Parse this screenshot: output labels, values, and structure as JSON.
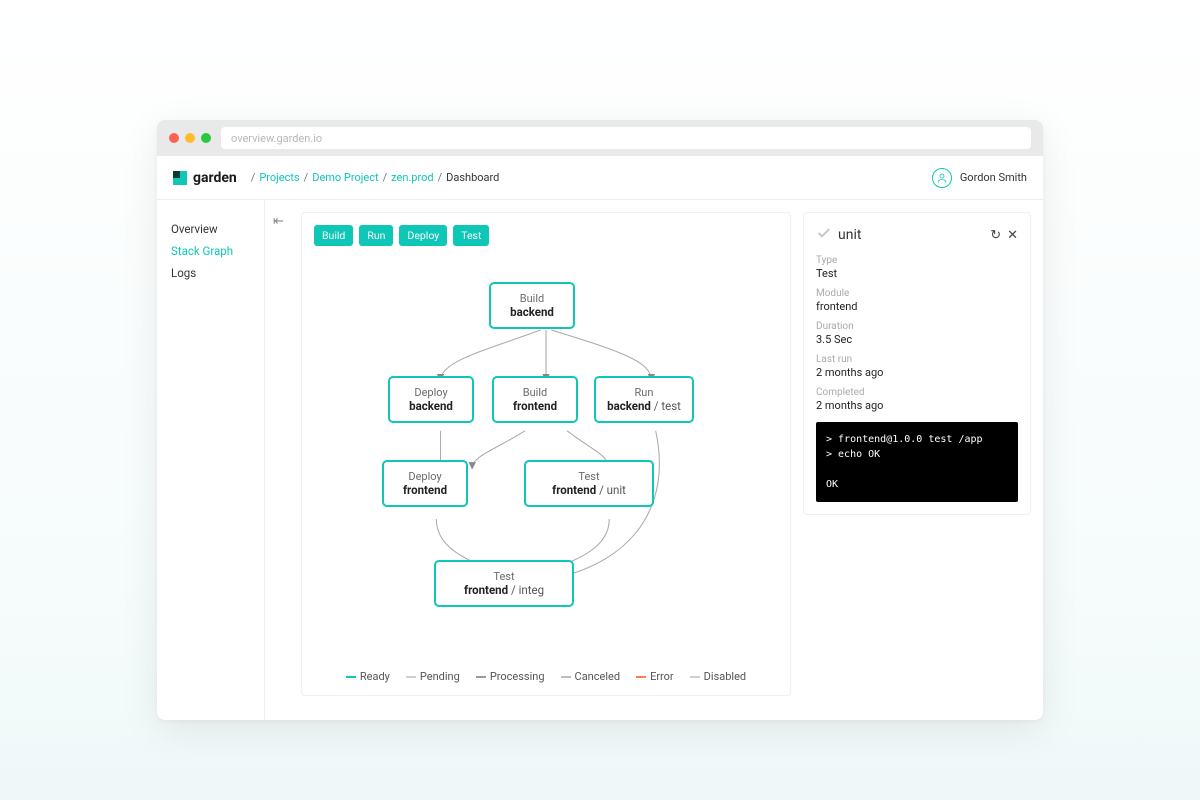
{
  "browser": {
    "url": "overview.garden.io"
  },
  "brand": "garden",
  "breadcrumbs": [
    "Projects",
    "Demo Project",
    "zen.prod",
    "Dashboard"
  ],
  "user": {
    "name": "Gordon Smith"
  },
  "sidebar": {
    "items": [
      {
        "label": "Overview",
        "active": false
      },
      {
        "label": "Stack Graph",
        "active": true
      },
      {
        "label": "Logs",
        "active": false
      }
    ]
  },
  "filters": [
    "Build",
    "Run",
    "Deploy",
    "Test"
  ],
  "legend": [
    {
      "label": "Ready",
      "color": "#0fc7b6"
    },
    {
      "label": "Pending",
      "color": "#cfcfcf"
    },
    {
      "label": "Processing",
      "color": "#9a9a9a"
    },
    {
      "label": "Canceled",
      "color": "#bdbdbd"
    },
    {
      "label": "Error",
      "color": "#ff7a59"
    },
    {
      "label": "Disabled",
      "color": "#d0d0d0"
    }
  ],
  "nodes": {
    "n1": {
      "type": "Build",
      "name": "backend"
    },
    "n2": {
      "type": "Deploy",
      "name": "backend"
    },
    "n3": {
      "type": "Build",
      "name": "frontend"
    },
    "n4": {
      "type": "Run",
      "name": "backend",
      "sub": "test"
    },
    "n5": {
      "type": "Deploy",
      "name": "frontend"
    },
    "n6": {
      "type": "Test",
      "name": "frontend",
      "sub": "unit"
    },
    "n7": {
      "type": "Test",
      "name": "frontend",
      "sub": "integ"
    }
  },
  "panel": {
    "title": "unit",
    "meta": {
      "type_label": "Type",
      "type_value": "Test",
      "module_label": "Module",
      "module_value": "frontend",
      "duration_label": "Duration",
      "duration_value": "3.5 Sec",
      "lastrun_label": "Last run",
      "lastrun_value": "2 months ago",
      "completed_label": "Completed",
      "completed_value": "2 months ago"
    },
    "terminal": "> frontend@1.0.0 test /app\n> echo OK\n\nOK"
  }
}
